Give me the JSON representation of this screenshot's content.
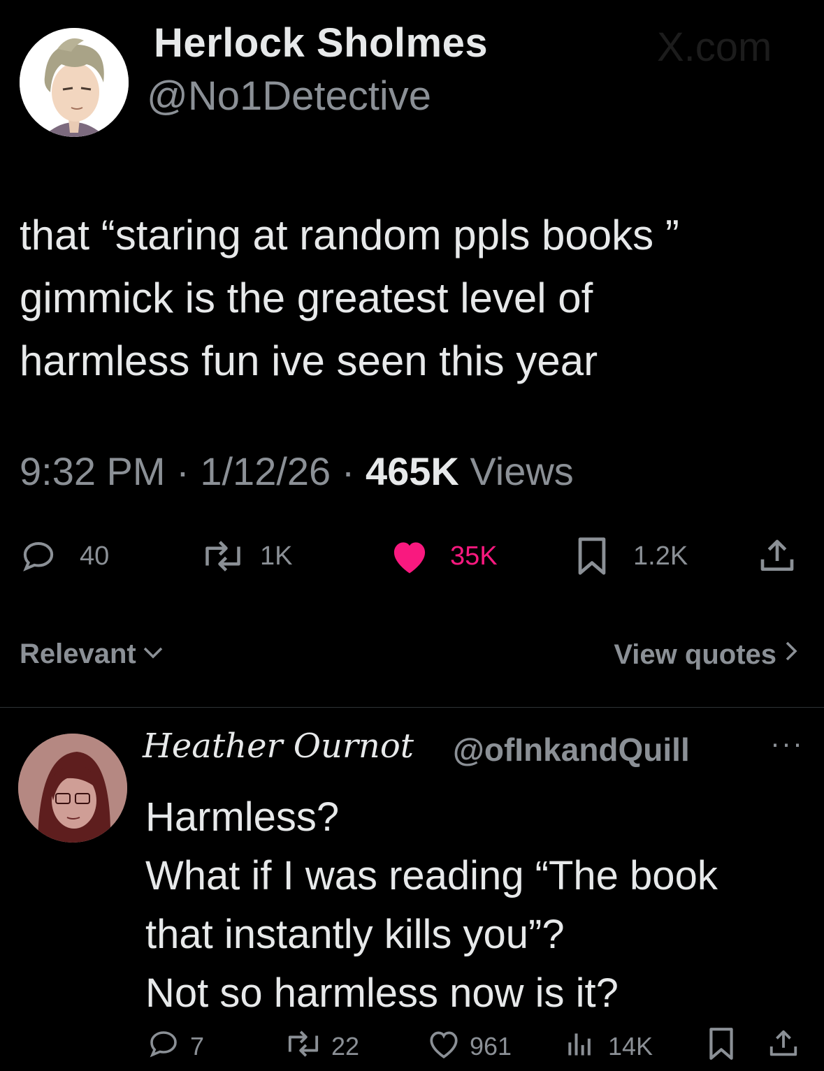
{
  "post": {
    "display_name": "Herlock Sholmes",
    "handle": "@No1Detective",
    "text": "that “staring at random ppls books ”\ngimmick is the greatest level of\nharmless fun ive seen this year",
    "time": "9:32 PM",
    "date": "1/12/26",
    "views_count": "465K",
    "views_label": "Views",
    "separator": "·",
    "stats": {
      "replies": "40",
      "reposts": "1K",
      "likes": "35K",
      "bookmarks": "1.2K"
    }
  },
  "watermark": "X.com",
  "replies_bar": {
    "sort_label": "Relevant",
    "view_quotes_label": "View quotes"
  },
  "reply": {
    "display_name": "Heather Ournot",
    "handle": "@ofInkandQuill",
    "more": "···",
    "text": "Harmless?\nWhat if I was reading “The book\nthat instantly kills you”?\nNot so harmless now is it?",
    "stats": {
      "replies": "7",
      "reposts": "22",
      "likes": "961",
      "views": "14K"
    }
  },
  "colors": {
    "background": "#000000",
    "text": "#e7e9ea",
    "muted": "#8b9096",
    "like": "#f9197f",
    "divider": "#2f3336"
  }
}
